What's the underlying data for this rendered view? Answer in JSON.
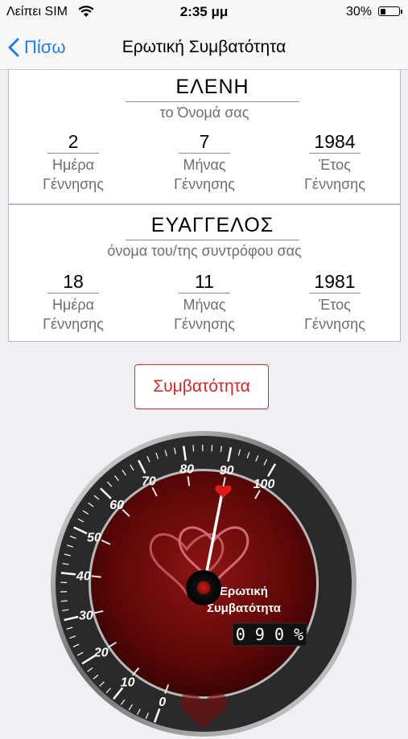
{
  "status_bar": {
    "carrier": "Λείπει SIM",
    "time": "2:35 μμ",
    "battery_percent": "30%",
    "battery_level": 0.3,
    "icons": [
      "wifi-icon",
      "battery-icon"
    ]
  },
  "nav": {
    "back_label": "Πίσω",
    "title": "Ερωτική Συμβατότητα"
  },
  "person1": {
    "name": "ΕΛΕΝΗ",
    "name_caption": "το Όνομά σας",
    "day": "2",
    "month": "7",
    "year": "1984",
    "day_label_1": "Ημέρα",
    "day_label_2": "Γέννησης",
    "month_label_1": "Μήνας",
    "month_label_2": "Γέννησης",
    "year_label_1": "Έτος",
    "year_label_2": "Γέννησης"
  },
  "person2": {
    "name": "ΕΥΑΓΓΕΛΟΣ",
    "name_caption": "όνομα του/της συντρόφου σας",
    "day": "18",
    "month": "11",
    "year": "1981",
    "day_label_1": "Ημέρα",
    "day_label_2": "Γέννησης",
    "month_label_1": "Μήνας",
    "month_label_2": "Γέννησης",
    "year_label_1": "Έτος",
    "year_label_2": "Γέννησης"
  },
  "compat_button": {
    "label": "Συμβατότητα"
  },
  "gauge": {
    "tick_labels": [
      "0",
      "10",
      "20",
      "30",
      "40",
      "50",
      "60",
      "70",
      "80",
      "90",
      "100"
    ],
    "label_line1": "Ερωτική",
    "label_line2": "Συμβατότητα",
    "readout": "0 9 0 %",
    "value": 90,
    "colors": {
      "dial": "#6b0a0a",
      "needle": "#ffffff",
      "needle_tip": "#e01a1a",
      "bezel": "#2a2a2a"
    }
  }
}
